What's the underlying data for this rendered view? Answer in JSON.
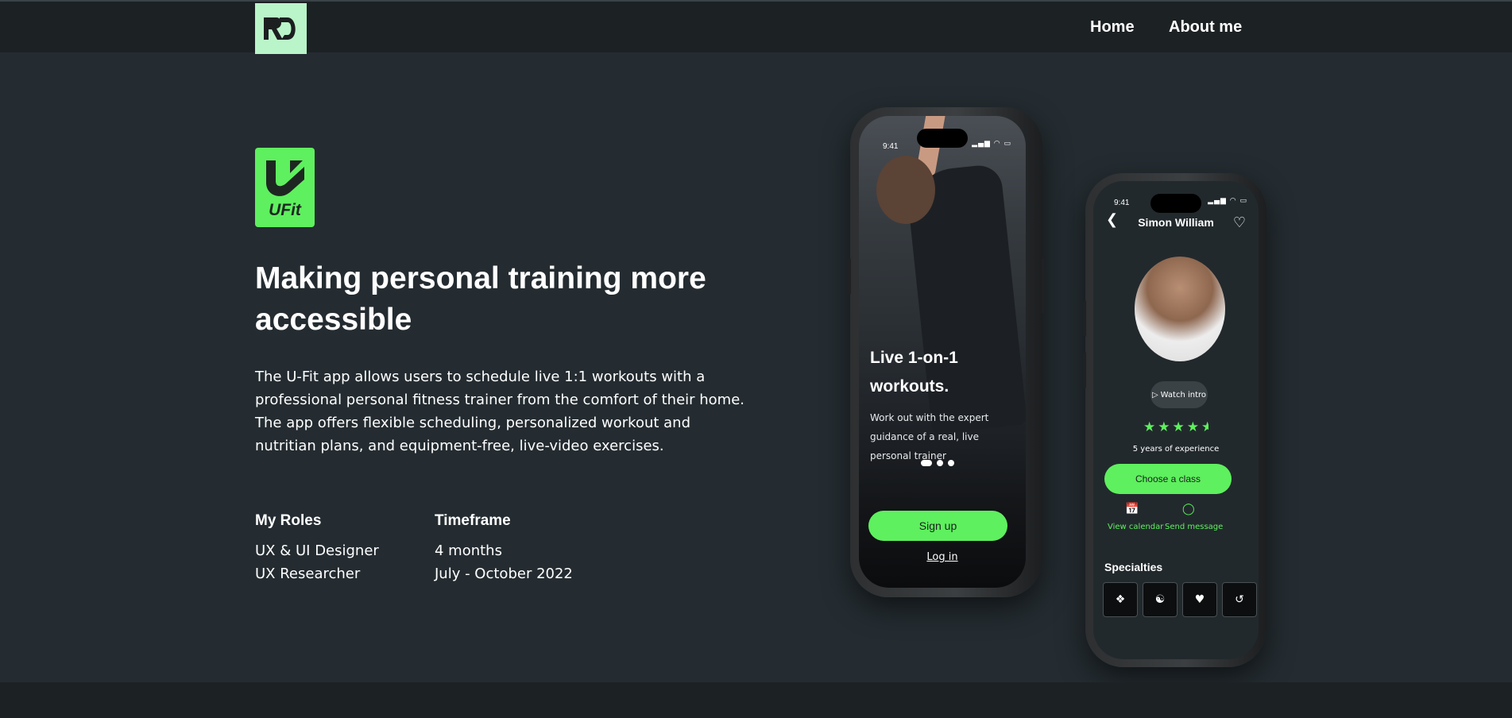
{
  "brand": {
    "logo_text": "RD",
    "accent": "#5ef05e",
    "logo_bg": "#b9f5c8"
  },
  "nav": {
    "home": "Home",
    "about": "About me"
  },
  "app_icon": {
    "label": "UFit"
  },
  "hero": {
    "headline": "Making personal training more accessible",
    "description": "The U-Fit app allows users to schedule live 1:1 workouts with a professional personal fitness trainer from the comfort of their home. The app offers flexible scheduling, personalized workout and nutritian plans, and equipment-free, live-video exercises."
  },
  "roles": {
    "title": "My Roles",
    "items": [
      "UX & UI Designer",
      "UX Researcher"
    ]
  },
  "timeframe": {
    "title": "Timeframe",
    "items": [
      "4 months",
      "July - October 2022"
    ]
  },
  "phone1": {
    "time": "9:41",
    "headline": "Live 1-on-1 workouts.",
    "subtext": "Work out with the expert guidance of a real, live personal trainer",
    "signup": "Sign up",
    "login": "Log in"
  },
  "phone2": {
    "time": "9:41",
    "trainer_name": "Simon William",
    "watch_intro": "Watch intro",
    "rating": 4.5,
    "experience": "5 years of experience",
    "choose_class": "Choose a class",
    "view_calendar": "View calendar",
    "send_message": "Send message",
    "specialties": "Specialties"
  }
}
